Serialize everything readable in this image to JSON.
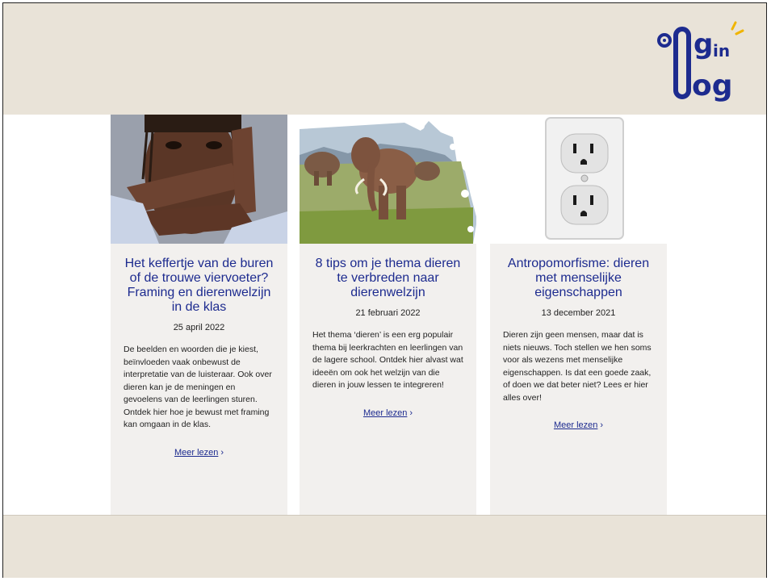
{
  "logo": {
    "text": "oog in oog",
    "colors": {
      "primary": "#1d2b8f",
      "accent": "#f0b400"
    }
  },
  "cards": [
    {
      "image": "framing-hands-portrait",
      "title": "Het keffertje van de buren of de trouwe viervoeter? Framing en dierenwelzijn in de klas",
      "date": "25 april 2022",
      "description": "De beelden en woorden die je kiest, beïnvloeden vaak onbewust de interpretatie van de luisteraar. Ook over dieren kan je de meningen en gevoelens van de leerlingen sturen. Ontdek hier hoe je bewust met framing kan omgaan in de klas.",
      "link": "Meer lezen"
    },
    {
      "image": "elephants-puzzle",
      "title": "8 tips om je thema dieren te verbreden naar dierenwelzijn",
      "date": "21 februari 2022",
      "description": "Het thema ‘dieren’ is een erg populair thema bij leerkrachten en leerlingen van de lagere school. Ontdek hier alvast wat ideeën om ook het welzijn van die dieren in jouw lessen te integreren!",
      "link": "Meer lezen"
    },
    {
      "image": "power-outlet",
      "title": "Antropomorfisme: dieren met menselijke eigenschappen",
      "date": "13 december 2021",
      "description": "Dieren zijn geen mensen, maar dat is niets nieuws. Toch stellen we hen soms voor als wezens met menselijke eigenschappen. Is dat een goede zaak, of doen we dat beter niet? Lees er hier alles over!",
      "link": "Meer lezen"
    }
  ],
  "colors": {
    "beige": "#e9e3d8",
    "card_bg": "#f2f0ee",
    "title_blue": "#1d2b8f"
  }
}
